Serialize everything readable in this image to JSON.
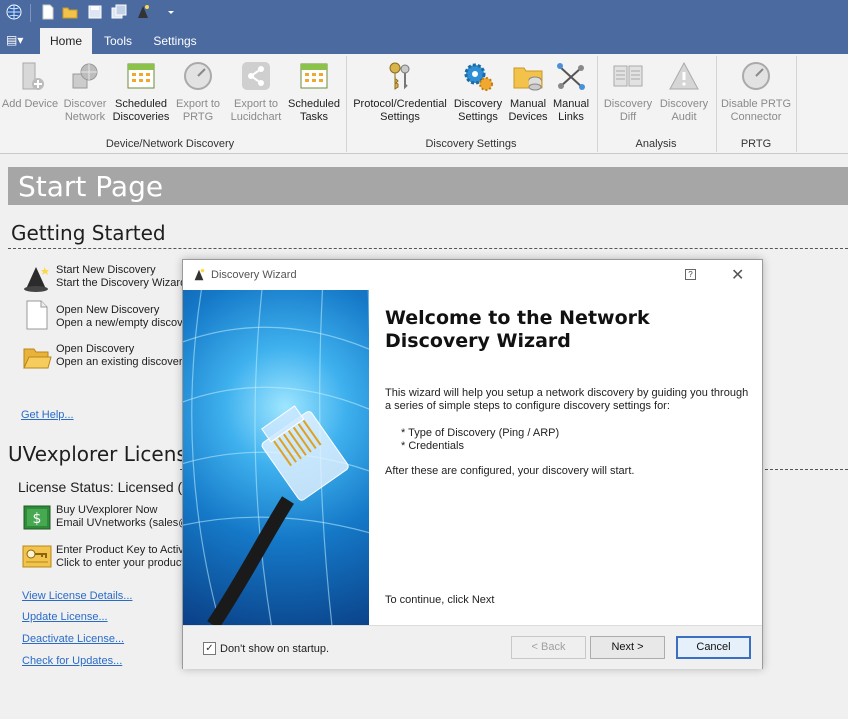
{
  "ribbon": {
    "tabs": [
      {
        "label": "Home",
        "active": true
      },
      {
        "label": "Tools",
        "active": false
      },
      {
        "label": "Settings",
        "active": false
      }
    ],
    "buttons": [
      {
        "label1": "Add Device",
        "label2": "",
        "enabled": false
      },
      {
        "label1": "Discover",
        "label2": "Network",
        "enabled": false
      },
      {
        "label1": "Scheduled",
        "label2": "Discoveries",
        "enabled": true
      },
      {
        "label1": "Export to",
        "label2": "PRTG",
        "enabled": false
      },
      {
        "label1": "Export to",
        "label2": "Lucidchart",
        "enabled": false
      },
      {
        "label1": "Scheduled",
        "label2": "Tasks",
        "enabled": true
      },
      {
        "label1": "Protocol/Credential",
        "label2": "Settings",
        "enabled": true
      },
      {
        "label1": "Discovery",
        "label2": "Settings",
        "enabled": true
      },
      {
        "label1": "Manual",
        "label2": "Devices",
        "enabled": true
      },
      {
        "label1": "Manual",
        "label2": "Links",
        "enabled": true
      },
      {
        "label1": "Discovery",
        "label2": "Diff",
        "enabled": false
      },
      {
        "label1": "Discovery",
        "label2": "Audit",
        "enabled": false
      },
      {
        "label1": "Disable PRTG",
        "label2": "Connector",
        "enabled": false
      }
    ],
    "groups": [
      "Device/Network Discovery",
      "Discovery Settings",
      "Analysis",
      "PRTG"
    ]
  },
  "start_page": {
    "title": "Start Page",
    "getting_started": {
      "heading": "Getting Started",
      "items": [
        {
          "line1": "Start New Discovery",
          "line2": "Start the Discovery Wizard",
          "icon": "wizard-hat-icon"
        },
        {
          "line1": "Open New Discovery",
          "line2": "Open a new/empty discovery",
          "icon": "blank-document-icon"
        },
        {
          "line1": "Open Discovery",
          "line2": "Open an existing discovery",
          "icon": "open-folder-icon"
        }
      ],
      "help_link": "Get Help..."
    },
    "license": {
      "heading": "UVexplorer License",
      "status": "License Status: Licensed (7",
      "items": [
        {
          "line1": "Buy UVexplorer Now",
          "line2": "Email UVnetworks (sales@",
          "icon": "money-icon"
        },
        {
          "line1": "Enter Product Key to Activ",
          "line2": "Click to enter your product",
          "icon": "product-key-icon"
        }
      ],
      "links": [
        "View License Details...",
        "Update License...",
        "Deactivate License...",
        "Check for Updates..."
      ]
    }
  },
  "dialog": {
    "title": "Discovery Wizard",
    "help_glyph": "?",
    "close_glyph": "✕",
    "heading": "Welcome to the Network Discovery Wizard",
    "intro": "This wizard will help you setup a network discovery by guiding you through a series of simple steps to configure discovery settings for:",
    "bullets": [
      "* Type of Discovery (Ping / ARP)",
      "* Credentials"
    ],
    "after": "After these are configured, your discovery will start.",
    "continue": "To continue, click Next",
    "checkbox": {
      "label": "Don't show on startup.",
      "checked": true,
      "mark": "✓"
    },
    "buttons": {
      "back": "< Back",
      "next": "Next >",
      "cancel": "Cancel"
    }
  }
}
